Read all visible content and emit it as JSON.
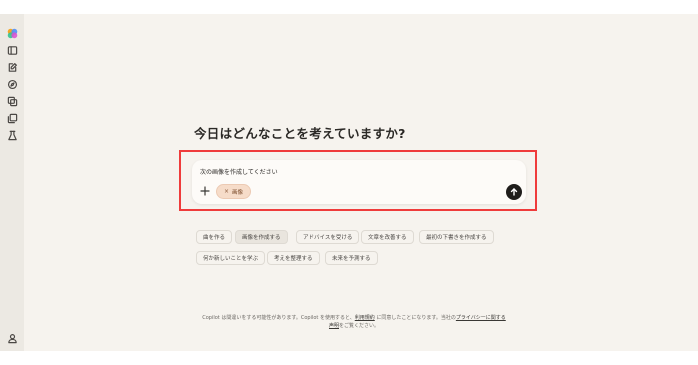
{
  "sidebar": {
    "icons": [
      "copilot-logo-icon",
      "sidebar-toggle-icon",
      "new-chat-icon",
      "discover-icon",
      "library-icon",
      "pages-icon",
      "labs-icon",
      "account-icon"
    ]
  },
  "main": {
    "heading": "今日はどんなことを考えていますか?",
    "composer": {
      "text": "次の画像を作成してください",
      "chip_label": "画像",
      "chip_x": "×"
    },
    "suggestions": [
      "曲を作る",
      "画像を作成する",
      "アドバイスを受ける",
      "文章を改善する",
      "最初の下書きを作成する",
      "何か新しいことを学ぶ",
      "考えを整理する",
      "未来を予測する"
    ],
    "footer": {
      "part1": "Copilot は間違いをする可能性があります。Copilot を使用すると、",
      "terms_link": "利用規約",
      "part2": " に同意したことになります。当社の",
      "privacy_link1": "プライバシーに関する",
      "privacy_link2": "声明",
      "part3": "をご覧ください。"
    }
  },
  "colors": {
    "highlight": "#ef3b3b",
    "send_button": "#1f1d1b",
    "chip_bg": "#f6dcc9"
  }
}
